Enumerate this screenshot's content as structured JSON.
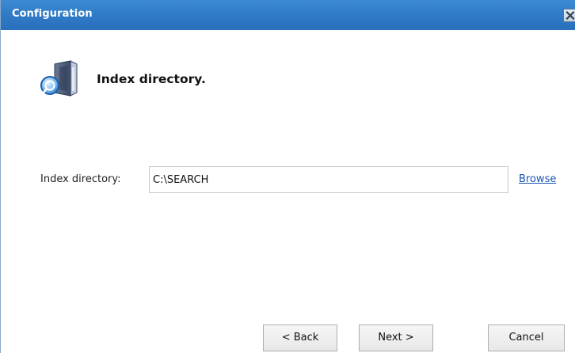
{
  "window": {
    "title": "Configuration"
  },
  "header": {
    "title": "Index directory.",
    "icon": "index-directory-icon"
  },
  "form": {
    "index_directory": {
      "label": "Index directory:",
      "value": "C:\\SEARCH"
    },
    "browse_label": "Browse"
  },
  "buttons": {
    "back": "< Back",
    "next": "Next >",
    "cancel": "Cancel"
  },
  "colors": {
    "titlebar": "#2f79c6",
    "link": "#1a56b4"
  }
}
